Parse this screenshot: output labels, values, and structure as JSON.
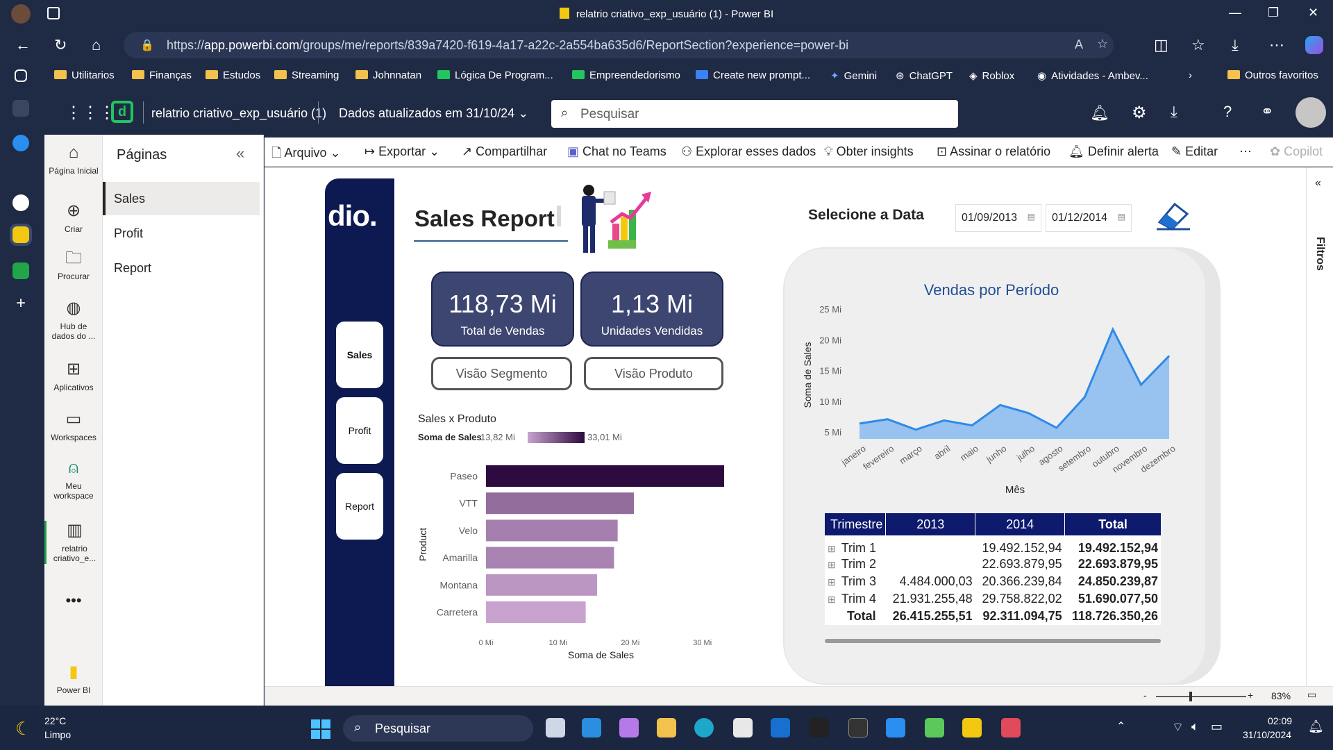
{
  "window": {
    "title": "relatrio criativo_exp_usuário (1) - Power BI"
  },
  "browser": {
    "url_prefix": "https://",
    "url_host": "app.powerbi.com",
    "url_path": "/groups/me/reports/839a7420-f619-4a17-a22c-2a554ba635d6/ReportSection?experience=power-bi",
    "bookmarks": [
      "Utilitarios",
      "Finanças",
      "Estudos",
      "Streaming",
      "Johnnatan",
      "Lógica De Program...",
      "Empreendedorismo",
      "Create new prompt...",
      "Gemini",
      "ChatGPT",
      "Roblox",
      "Atividades - Ambev..."
    ],
    "other_favorites": "Outros favoritos"
  },
  "pbi": {
    "report_name": "relatrio criativo_exp_usuário (1)",
    "updated": "Dados atualizados em 31/10/24",
    "search_placeholder": "Pesquisar",
    "nav": [
      {
        "label": "Página Inicial",
        "icon": "home-icon"
      },
      {
        "label": "Criar",
        "icon": "plus-circle-icon"
      },
      {
        "label": "Procurar",
        "icon": "folder-icon"
      },
      {
        "label": "Hub de dados do ...",
        "icon": "data-hub-icon"
      },
      {
        "label": "Aplicativos",
        "icon": "apps-icon"
      },
      {
        "label": "Workspaces",
        "icon": "workspaces-icon"
      },
      {
        "label": "Meu workspace",
        "icon": "person-icon"
      },
      {
        "label": "relatrio criativo_e...",
        "icon": "report-icon"
      }
    ],
    "powerbi_label": "Power BI",
    "pages_title": "Páginas",
    "pages": [
      "Sales",
      "Profit",
      "Report"
    ],
    "toolbar": [
      "Arquivo",
      "Exportar",
      "Compartilhar",
      "Chat no Teams",
      "Explorar esses dados",
      "Obter insights",
      "Assinar o relatório",
      "Definir alerta",
      "Editar",
      "Copilot"
    ],
    "filters_label": "Filtros",
    "zoom": "83%"
  },
  "report": {
    "logo": "dio.",
    "title": "Sales Report",
    "side_buttons": [
      "Sales",
      "Profit",
      "Report"
    ],
    "kpis": [
      {
        "value": "118,73 Mi",
        "label": "Total de Vendas"
      },
      {
        "value": "1,13 Mi",
        "label": "Unidades Vendidas"
      }
    ],
    "view_buttons": [
      "Visão Segmento",
      "Visão Produto"
    ],
    "date_label": "Selecione a Data",
    "date_from": "01/09/2013",
    "date_to": "01/12/2014"
  },
  "chart_data": [
    {
      "type": "bar",
      "title": "Sales x Produto",
      "legend_label": "Soma de  Sales",
      "legend_min": "13,82 Mi",
      "legend_max": "33,01 Mi",
      "categories": [
        "Paseo",
        "VTT",
        "Velo",
        "Amarilla",
        "Montana",
        "Carretera"
      ],
      "values": [
        33.01,
        20.5,
        18.25,
        17.75,
        15.4,
        13.82
      ],
      "xlabel": "Soma de Sales",
      "ylabel": "Product",
      "xticks": [
        "0 Mi",
        "10 Mi",
        "20 Mi",
        "30 Mi"
      ],
      "xlim": [
        0,
        33.01
      ],
      "colors": {
        "low": "#c9a3cf",
        "high": "#2d0a3f"
      }
    },
    {
      "type": "area",
      "title": "Vendas por Período",
      "xlabel": "Mês",
      "ylabel": "Soma de Sales",
      "categories": [
        "janeiro",
        "fevereiro",
        "março",
        "abril",
        "maio",
        "junho",
        "julho",
        "agosto",
        "setembro",
        "outubro",
        "novembro",
        "dezembro"
      ],
      "values": [
        6.5,
        7.2,
        5.5,
        7.0,
        6.2,
        9.5,
        8.2,
        5.8,
        10.8,
        21.8,
        12.8,
        17.5
      ],
      "yticks": [
        "5 Mi",
        "10 Mi",
        "15 Mi",
        "20 Mi",
        "25 Mi"
      ],
      "ylim": [
        4,
        25
      ],
      "color": "#5ea3ee"
    },
    {
      "type": "table",
      "columns": [
        "Trimestre",
        "2013",
        "2014",
        "Total"
      ],
      "rows": [
        [
          "Trim 1",
          "",
          "19.492.152,94",
          "19.492.152,94"
        ],
        [
          "Trim 2",
          "",
          "22.693.879,95",
          "22.693.879,95"
        ],
        [
          "Trim 3",
          "4.484.000,03",
          "20.366.239,84",
          "24.850.239,87"
        ],
        [
          "Trim 4",
          "21.931.255,48",
          "29.758.822,02",
          "51.690.077,50"
        ]
      ],
      "total_row": [
        "Total",
        "26.415.255,51",
        "92.311.094,75",
        "118.726.350,26"
      ]
    }
  ],
  "taskbar": {
    "temp": "22°C",
    "weather": "Limpo",
    "search": "Pesquisar",
    "time": "02:09",
    "date": "31/10/2024"
  }
}
